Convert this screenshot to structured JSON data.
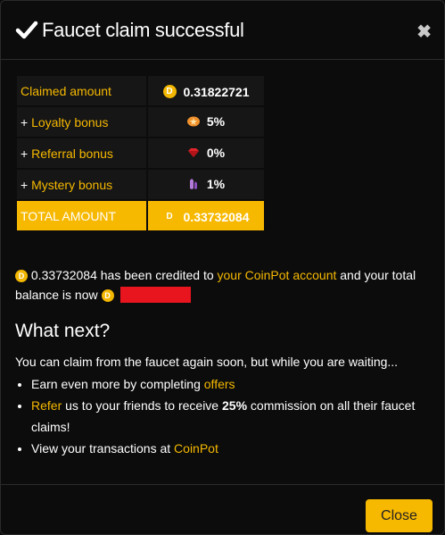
{
  "modal": {
    "title": "Faucet claim successful",
    "close_x": "✖",
    "accent_color": "#f7b800"
  },
  "summary": {
    "rows": [
      {
        "label": "Claimed amount",
        "prefix": "",
        "icon": "coin-icon",
        "value": "0.31822721"
      },
      {
        "label": "Loyalty bonus",
        "prefix": "+ ",
        "icon": "orange-badge-icon",
        "value": "5%"
      },
      {
        "label": "Referral bonus",
        "prefix": "+ ",
        "icon": "red-gem-icon",
        "value": "0%"
      },
      {
        "label": "Mystery bonus",
        "prefix": "+ ",
        "icon": "purple-crystal-icon",
        "value": "1%"
      }
    ],
    "total": {
      "label": "TOTAL AMOUNT",
      "icon": "coin-icon",
      "value": "0.33732084"
    }
  },
  "credit": {
    "amount": "0.33732084",
    "text1": " has been credited to ",
    "link": "your CoinPot account",
    "text2": " and your total balance is now "
  },
  "next": {
    "title": "What next?",
    "intro": "You can claim from the faucet again soon, but while you are waiting...",
    "item1_text": "Earn even more by completing ",
    "item1_link": "offers",
    "item2_link": "Refer",
    "item2_text": " us to your friends to receive ",
    "item2_bold": "25%",
    "item2_tail": " commission on all their faucet claims!",
    "item3_text": "View your transactions at ",
    "item3_link": "CoinPot"
  },
  "footer": {
    "close_label": "Close"
  }
}
